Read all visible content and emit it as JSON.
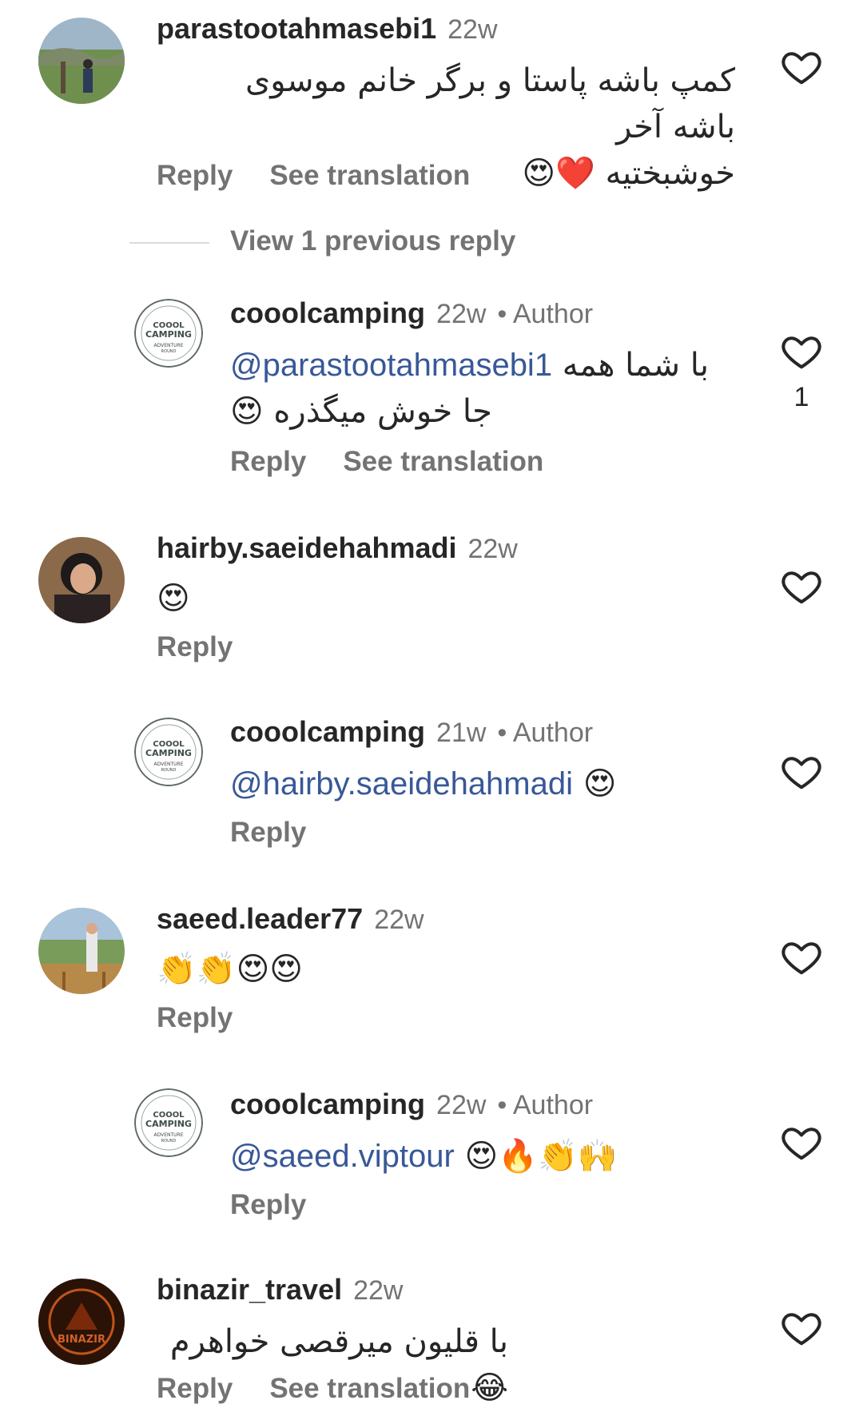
{
  "comments": [
    {
      "user": "parastootahmasebi1",
      "time": "22w",
      "text_line1": "کمپ باشه پاستا و برگر خانم موسوی باشه آخر",
      "text_line2": "خوشبختیه ❤️😍",
      "reply": "Reply",
      "translation": "See translation"
    },
    {
      "user": "cooolcamping",
      "time": "22w",
      "author": "• Author",
      "mention": "@parastootahmasebi1",
      "text_line1": "با شما همه",
      "text_line2": "جا خوش میگذره 😍",
      "reply": "Reply",
      "translation": "See translation",
      "like_count": "1"
    },
    {
      "user": "hairby.saeidehahmadi",
      "time": "22w",
      "text": "😍",
      "reply": "Reply"
    },
    {
      "user": "cooolcamping",
      "time": "21w",
      "author": "• Author",
      "mention": "@hairby.saeidehahmadi",
      "text": "😍",
      "reply": "Reply"
    },
    {
      "user": "saeed.leader77",
      "time": "22w",
      "text": "👏👏😍😍",
      "reply": "Reply"
    },
    {
      "user": "cooolcamping",
      "time": "22w",
      "author": "• Author",
      "mention": "@saeed.viptour",
      "text": "😍🔥👏🙌",
      "reply": "Reply"
    },
    {
      "user": "binazir_travel",
      "time": "22w",
      "text": "با قلیون میرقصی خواهرم😂",
      "reply": "Reply",
      "translation": "See translation"
    }
  ],
  "view_previous": "View 1 previous reply",
  "avatar_logo": {
    "line1": "COOOL",
    "line2": "CAMPING",
    "line3": "ADVENTURE",
    "line4": "ROUND"
  },
  "avatar_binazir": "BINAZIR",
  "icons": {
    "like": "heart-outline-icon"
  },
  "colors": {
    "text": "#262626",
    "secondary": "#737373",
    "mention": "#385898"
  }
}
